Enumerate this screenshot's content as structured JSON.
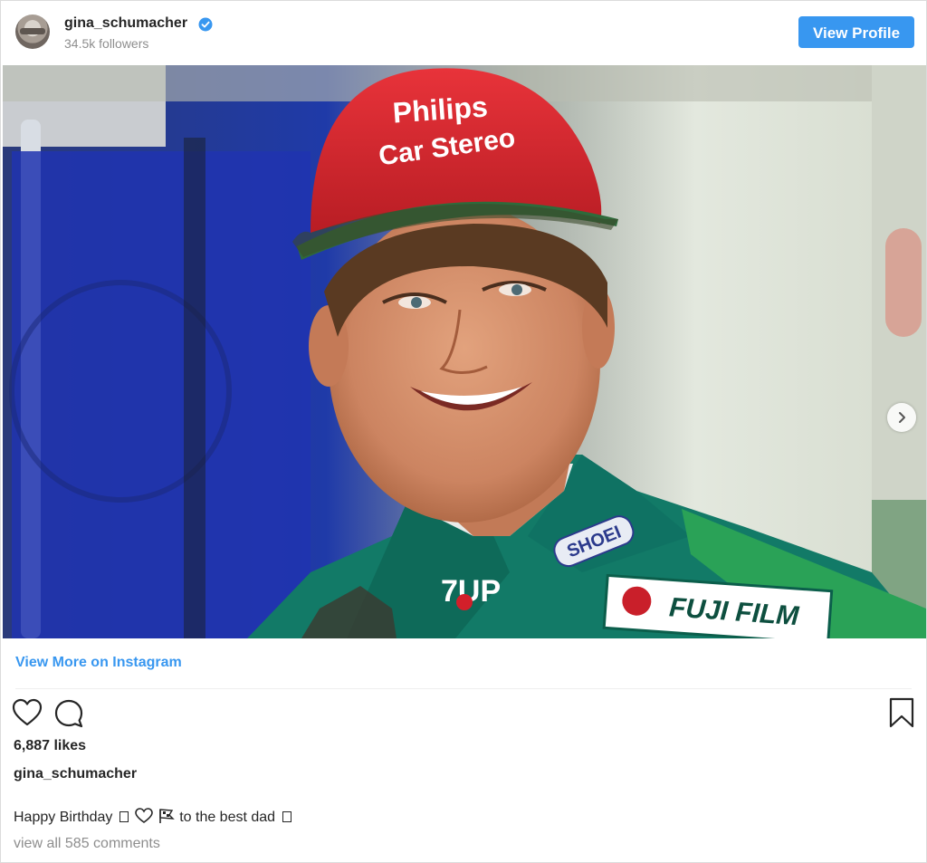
{
  "header": {
    "username": "gina_schumacher",
    "followers": "34.5k followers",
    "view_profile_label": "View Profile"
  },
  "photo": {
    "cap_line1": "Philips",
    "cap_line2": "Car Stereo",
    "badge_shoei": "SHOEI",
    "badge_7up": "7UP",
    "badge_fujifilm": "FUJI FILM"
  },
  "view_more_label": "View More on Instagram",
  "likes": "6,887 likes",
  "caption": {
    "username": "gina_schumacher",
    "part1": "Happy Birthday",
    "part2": "to the best dad"
  },
  "comments_link": "view all 585 comments",
  "colors": {
    "accent": "#3897f0",
    "text": "#262626",
    "muted": "#8e8e8e"
  }
}
